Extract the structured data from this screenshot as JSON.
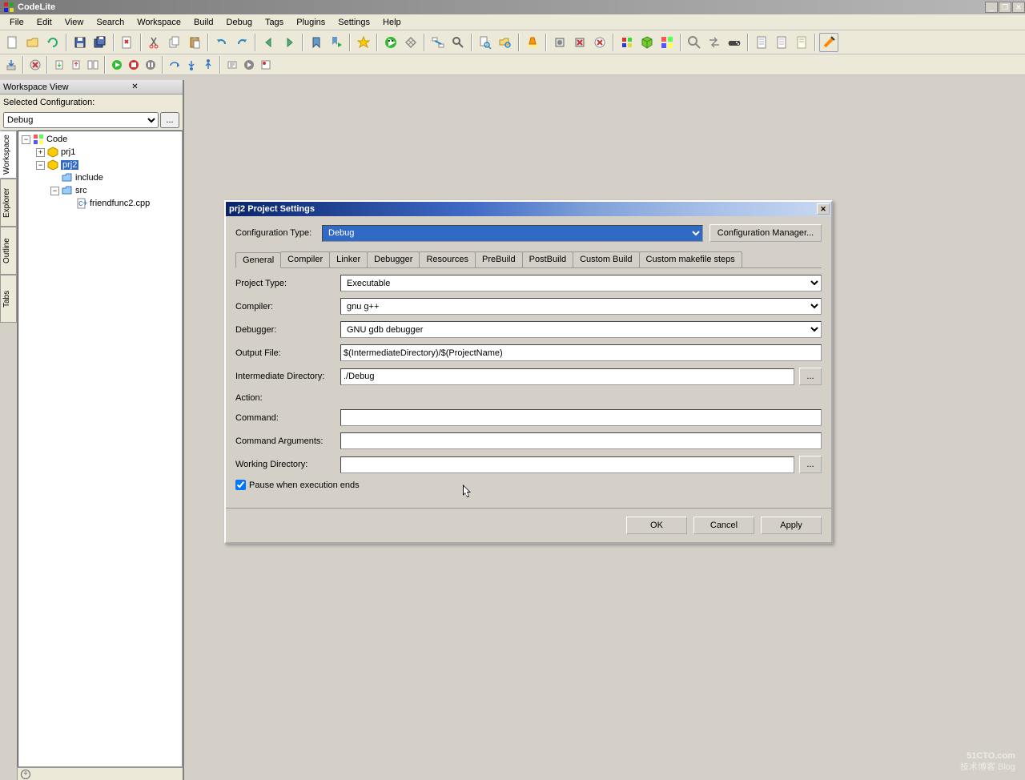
{
  "app": {
    "title": "CodeLite"
  },
  "menu": [
    "File",
    "Edit",
    "View",
    "Search",
    "Workspace",
    "Build",
    "Debug",
    "Tags",
    "Plugins",
    "Settings",
    "Help"
  ],
  "workspace": {
    "panel_title": "Workspace View",
    "config_label": "Selected Configuration:",
    "config_value": "Debug",
    "config_browse": "...",
    "side_tabs": [
      "Workspace",
      "Explorer",
      "Outline",
      "Tabs"
    ],
    "tree": {
      "root": "Code",
      "items": [
        {
          "name": "prj1",
          "depth": 1,
          "expand": "plus",
          "icon": "project"
        },
        {
          "name": "prj2",
          "depth": 1,
          "expand": "minus",
          "icon": "project",
          "selected": true
        },
        {
          "name": "include",
          "depth": 2,
          "expand": "none",
          "icon": "folder"
        },
        {
          "name": "src",
          "depth": 2,
          "expand": "minus",
          "icon": "folder"
        },
        {
          "name": "friendfunc2.cpp",
          "depth": 3,
          "expand": "none",
          "icon": "cpp"
        }
      ]
    }
  },
  "dialog": {
    "title": "prj2 Project Settings",
    "config_type_label": "Configuration Type:",
    "config_type_value": "Debug",
    "config_manager": "Configuration Manager...",
    "tabs": [
      "General",
      "Compiler",
      "Linker",
      "Debugger",
      "Resources",
      "PreBuild",
      "PostBuild",
      "Custom Build",
      "Custom makefile steps"
    ],
    "active_tab": 0,
    "fields": {
      "project_type": {
        "label": "Project Type:",
        "value": "Executable",
        "type": "select"
      },
      "compiler": {
        "label": "Compiler:",
        "value": "gnu g++",
        "type": "select"
      },
      "debugger": {
        "label": "Debugger:",
        "value": "GNU gdb debugger",
        "type": "select"
      },
      "output_file": {
        "label": "Output File:",
        "value": "$(IntermediateDirectory)/$(ProjectName)",
        "type": "text"
      },
      "int_dir": {
        "label": "Intermediate Directory:",
        "value": "./Debug",
        "type": "text",
        "browse": true
      },
      "action_label": "Action:",
      "command": {
        "label": "Command:",
        "value": "",
        "type": "text"
      },
      "cmd_args": {
        "label": "Command Arguments:",
        "value": "",
        "type": "text"
      },
      "work_dir": {
        "label": "Working Directory:",
        "value": "",
        "type": "text",
        "browse": true
      },
      "pause": {
        "label": "Pause when execution ends",
        "checked": true
      }
    },
    "buttons": {
      "ok": "OK",
      "cancel": "Cancel",
      "apply": "Apply"
    },
    "browse": "..."
  },
  "watermark": {
    "main": "51CTO.com",
    "sub": "技术博客  Blog"
  }
}
